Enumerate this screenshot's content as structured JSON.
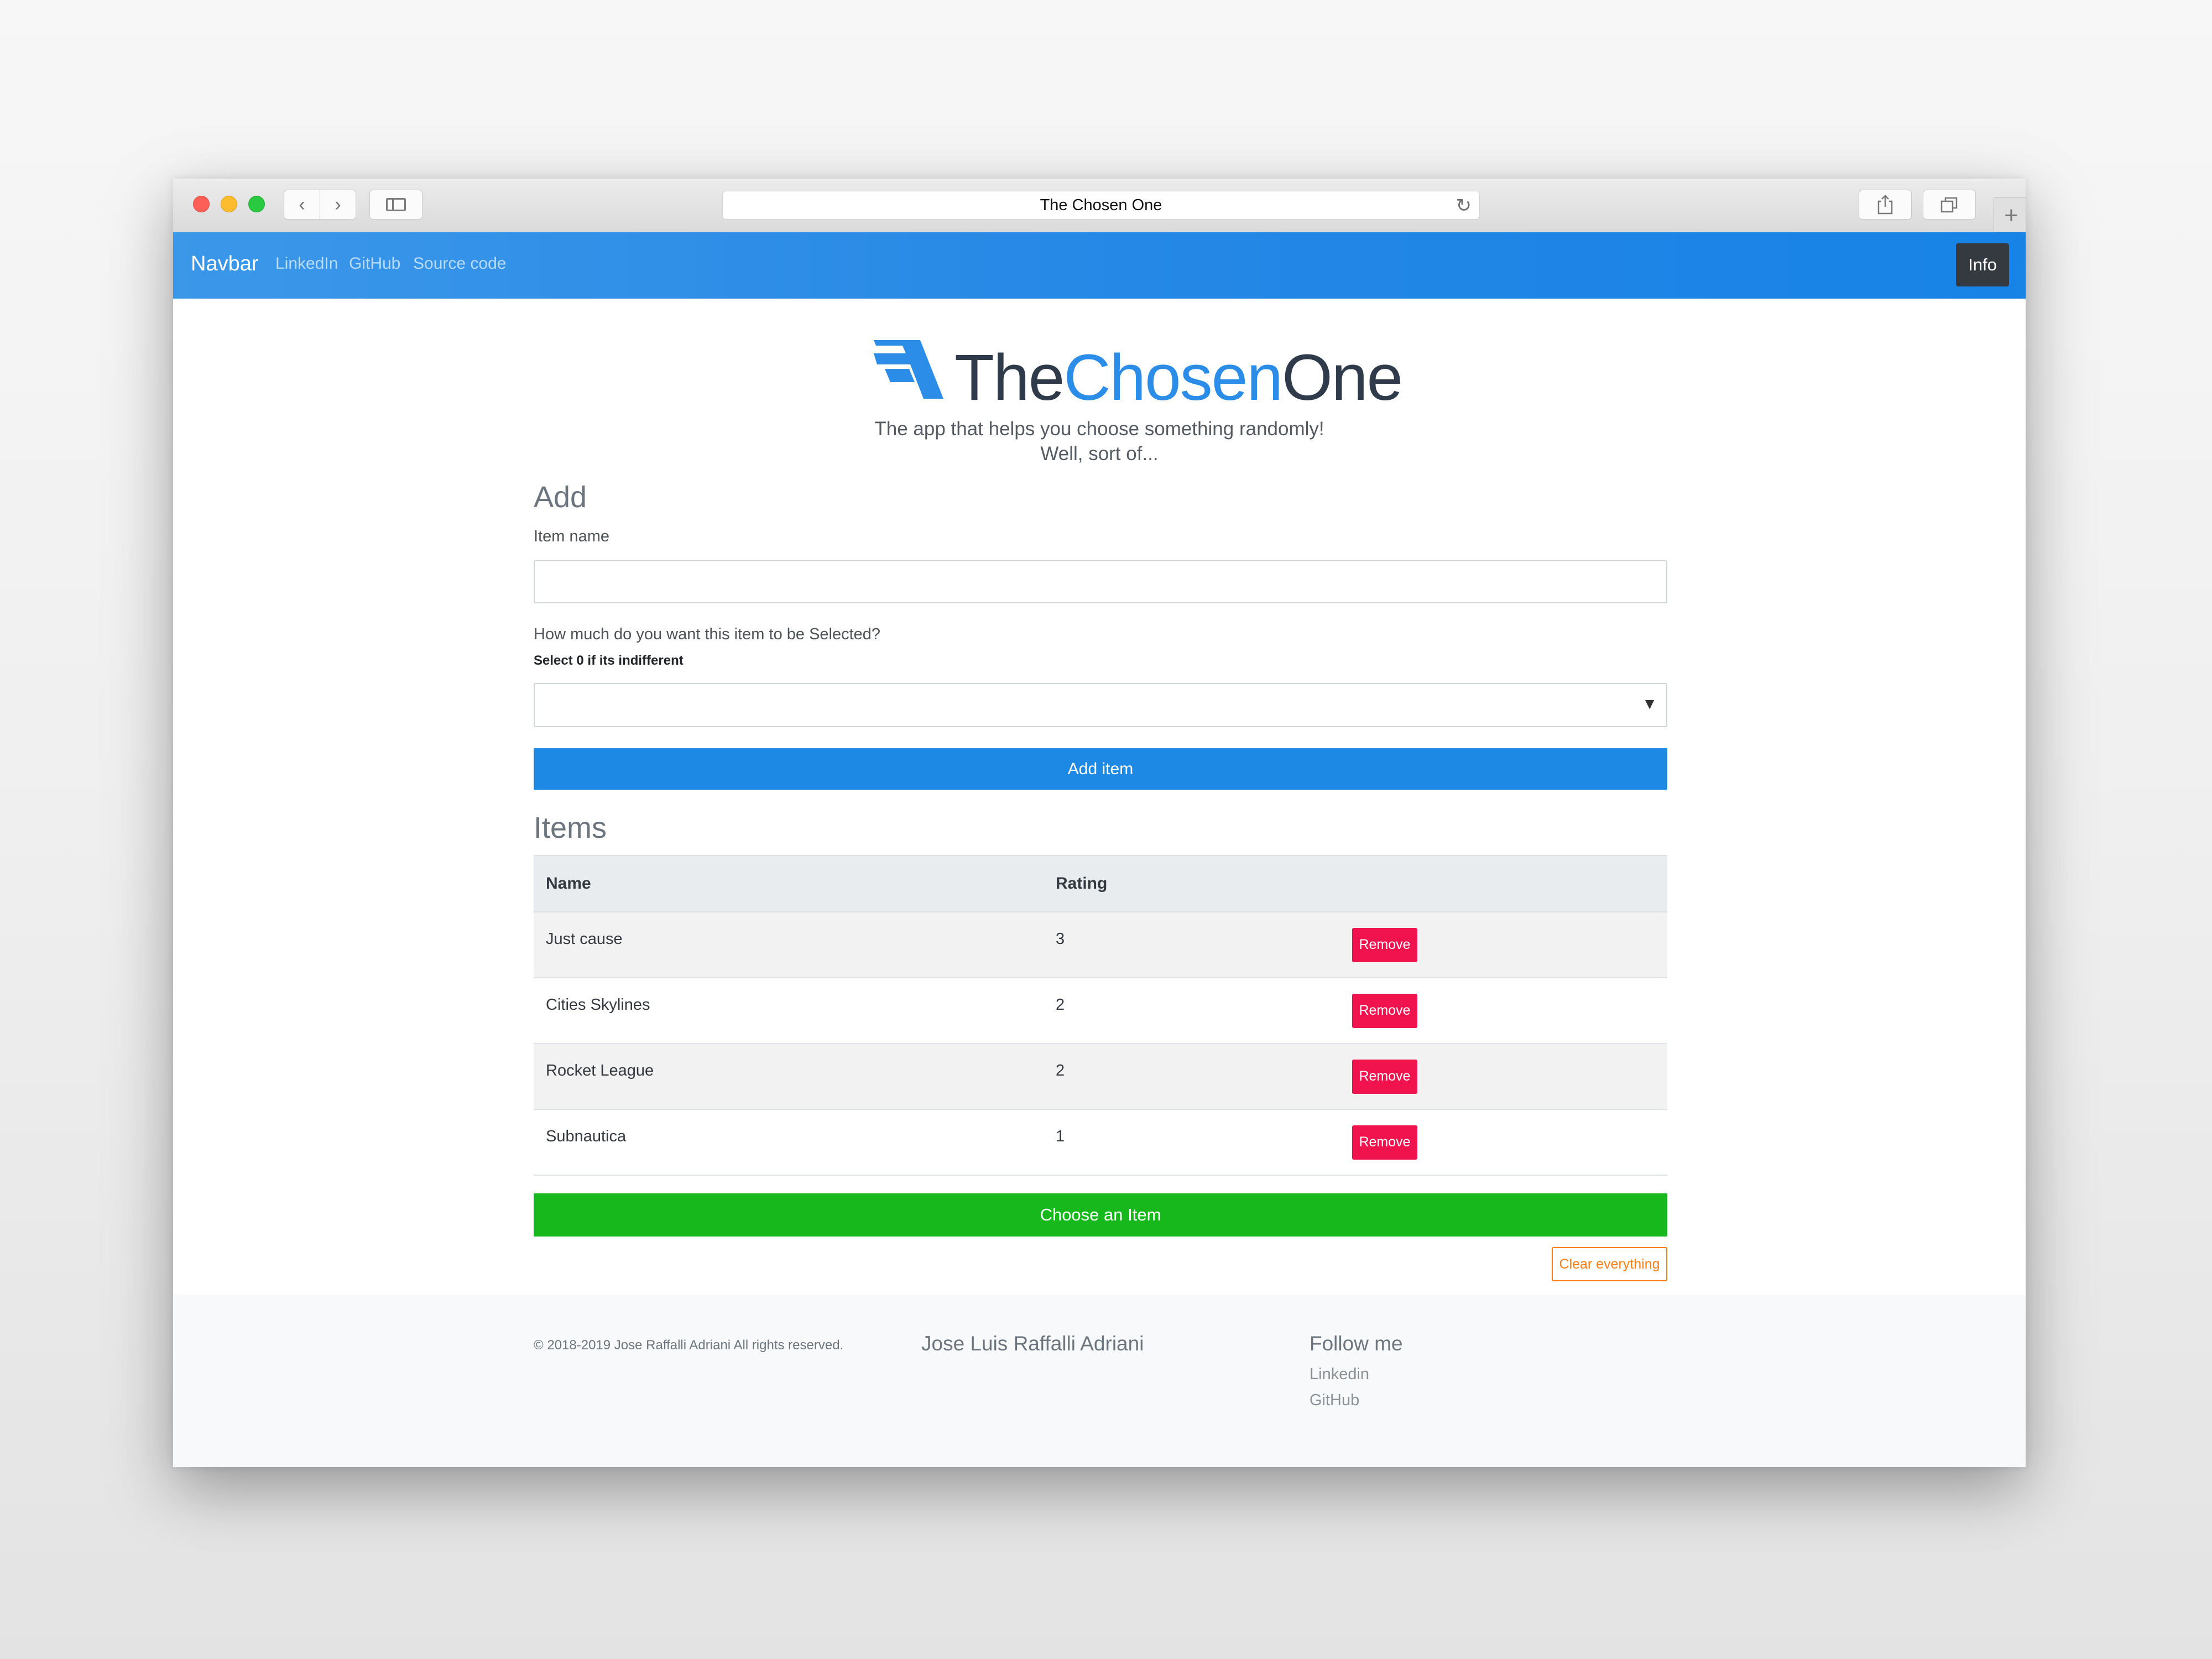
{
  "browser": {
    "url_title": "The Chosen One",
    "tab_plus": "+"
  },
  "navbar": {
    "brand": "Navbar",
    "links": [
      "LinkedIn",
      "GitHub",
      "Source code"
    ],
    "info_button": "Info"
  },
  "header": {
    "logo_part1": "The",
    "logo_part2": "Chosen",
    "logo_part3": "One",
    "tagline_1": "The app that helps you choose something randomly!",
    "tagline_2": "Well, sort of..."
  },
  "add_section": {
    "title": "Add",
    "item_name_label": "Item name",
    "item_name_value": "",
    "rating_label": "How much do you want this item to be Selected?",
    "rating_hint": "Select 0 if its indifferent",
    "rating_selected": "",
    "add_button": "Add item"
  },
  "items_section": {
    "title": "Items",
    "columns": [
      "Name",
      "Rating",
      ""
    ],
    "rows": [
      {
        "name": "Just cause",
        "rating": "3",
        "action": "Remove"
      },
      {
        "name": "Cities Skylines",
        "rating": "2",
        "action": "Remove"
      },
      {
        "name": "Rocket League",
        "rating": "2",
        "action": "Remove"
      },
      {
        "name": "Subnautica",
        "rating": "1",
        "action": "Remove"
      }
    ],
    "choose_button": "Choose an Item",
    "clear_button": "Clear everything"
  },
  "footer": {
    "copyright": "© 2018-2019 Jose Raffalli Adriani All rights reserved.",
    "author": "Jose Luis Raffalli Adriani",
    "follow_title": "Follow me",
    "follow_links": [
      "Linkedin",
      "GitHub"
    ]
  },
  "colors": {
    "navbar": "#2487e6",
    "primary_button": "#1d89e4",
    "success_button": "#16b81c",
    "danger_button": "#f0134d",
    "warning_outline": "#fd7e14"
  }
}
